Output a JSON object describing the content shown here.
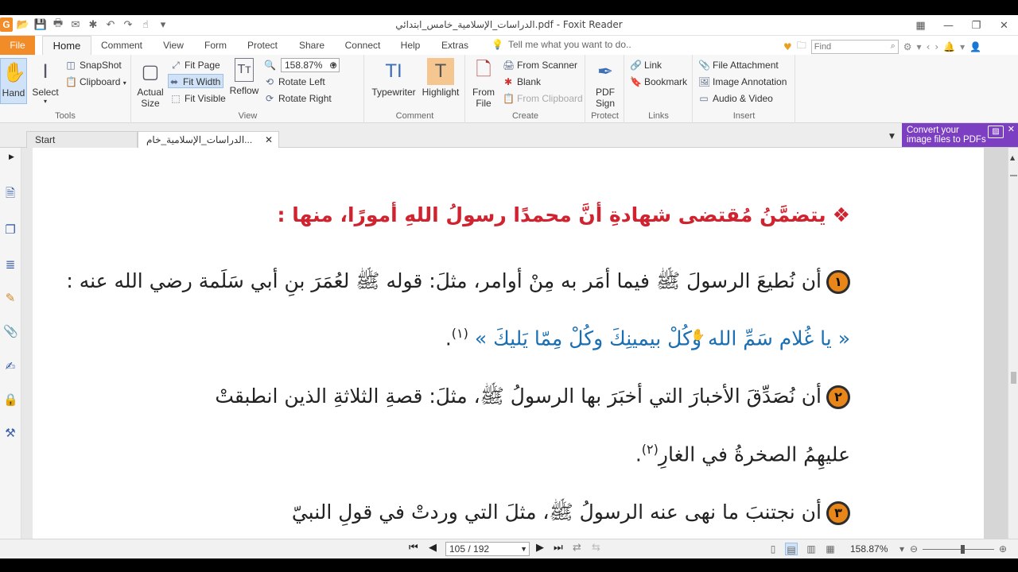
{
  "window": {
    "title": "الدراسات_الإسلامية_خامس_ابتدائي.pdf - Foxit Reader"
  },
  "ribbon_tabs": [
    "File",
    "Home",
    "Comment",
    "View",
    "Form",
    "Protect",
    "Share",
    "Connect",
    "Help",
    "Extras"
  ],
  "active_tab": "Home",
  "tell_me": "Tell me what you want to do..",
  "find": {
    "placeholder": "Find"
  },
  "tools_group": {
    "label": "Tools",
    "hand": "Hand",
    "select": "Select",
    "snapshot": "SnapShot",
    "clipboard": "Clipboard"
  },
  "view_group": {
    "label": "View",
    "actual_size": [
      "Actual",
      "Size"
    ],
    "fit_page": "Fit Page",
    "fit_width": "Fit Width",
    "fit_visible": "Fit Visible",
    "reflow": "Reflow",
    "zoom": "158.87%",
    "rotate_left": "Rotate Left",
    "rotate_right": "Rotate Right"
  },
  "comment_group": {
    "label": "Comment",
    "typewriter": "Typewriter",
    "highlight": "Highlight"
  },
  "create_group": {
    "label": "Create",
    "from_file": [
      "From",
      "File"
    ],
    "from_scanner": "From Scanner",
    "blank": "Blank",
    "from_clipboard": "From Clipboard"
  },
  "protect_group": {
    "label": "Protect",
    "pdf_sign": [
      "PDF",
      "Sign"
    ]
  },
  "links_group": {
    "label": "Links",
    "link": "Link",
    "bookmark": "Bookmark"
  },
  "insert_group": {
    "label": "Insert",
    "file_attachment": "File Attachment",
    "image_annotation": "Image Annotation",
    "audio_video": "Audio & Video"
  },
  "doc_tabs": {
    "start": "Start",
    "document": "الدراسات_الإسلامية_خام..."
  },
  "promo": [
    "Convert your",
    "image files to PDFs"
  ],
  "document": {
    "heading": "يتضمَّنُ مُقتضى شهادةِ أنَّ محمدًا رسولُ اللهِ أمورًا، منها :",
    "heading_bullet": "❖",
    "item1_num": "١",
    "item1_line1": "أن نُطيعَ الرسولَ ﷺ فيما أمَر به مِنْ أوامر، مثلَ: قوله ﷺ لعُمَرَ بنِ أبي سَلَمة رضي الله عنه :",
    "item1_quote": "« يا غُلام سَمِّ الله وكُلْ بيمينِكَ وكُلْ مِمّا يَليكَ »",
    "item1_fn": "(١)",
    "item1_end": ".",
    "item2_num": "٢",
    "item2_line1": "أن نُصَدِّقَ الأخبارَ التي أخبَرَ بها الرسولُ ﷺ، مثلَ: قصةِ الثلاثةِ الذين انطبقتْ",
    "item2_line2": "عليهِمُ الصخرةُ في الغارِ",
    "item2_fn": "(٢)",
    "item2_end": ".",
    "item3_num": "٣",
    "item3_line1": "أن نجتنبَ ما نهى عنه الرسولُ ﷺ، مثلَ التي وردتْ في قولِ النبيّ"
  },
  "status": {
    "page": "105 / 192",
    "zoom": "158.87%"
  }
}
